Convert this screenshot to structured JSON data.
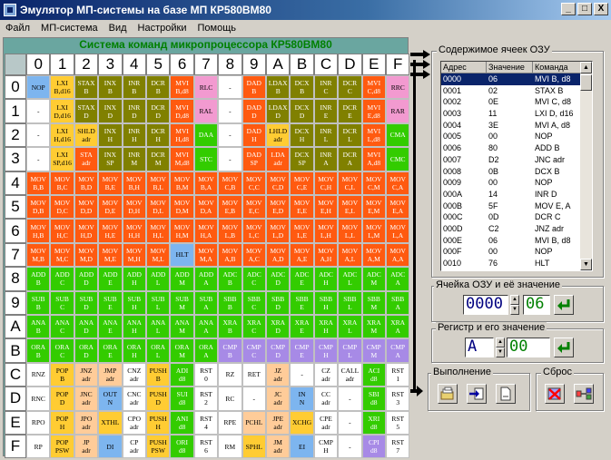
{
  "window": {
    "title": "Эмулятор МП-системы на базе МП КР580ВМ80",
    "min": "_",
    "max": "□",
    "close": "X"
  },
  "menu": [
    "Файл",
    "МП-система",
    "Вид",
    "Настройки",
    "Помощь"
  ],
  "system_title": "Система команд микропроцессора КР580ВМ80",
  "hex_digits": [
    "0",
    "1",
    "2",
    "3",
    "4",
    "5",
    "6",
    "7",
    "8",
    "9",
    "A",
    "B",
    "C",
    "D",
    "E",
    "F"
  ],
  "color_map": {
    "brown": "#808000",
    "orange": "#ff5a10",
    "green": "#33cc00",
    "purple": "#a78ae6",
    "yellow": "#ffcc33",
    "white": "#ffffff",
    "blue": "#7db5ef",
    "pink": "#f29ad0",
    "peach": "#ffcc99",
    "lgreen": "#aaf0a0"
  },
  "opcode_rows": [
    [
      {
        "t": "NOP",
        "c": "blue"
      },
      {
        "t": "LXI B,d16",
        "c": "yellow"
      },
      {
        "t": "STAX B",
        "c": "brown"
      },
      {
        "t": "INX B",
        "c": "brown"
      },
      {
        "t": "INR B",
        "c": "brown"
      },
      {
        "t": "DCR B",
        "c": "brown"
      },
      {
        "t": "MVI B,d8",
        "c": "orange"
      },
      {
        "t": "RLC",
        "c": "pink"
      },
      {
        "t": "-",
        "c": "white"
      },
      {
        "t": "DAD B",
        "c": "orange"
      },
      {
        "t": "LDAX B",
        "c": "brown"
      },
      {
        "t": "DCX B",
        "c": "brown"
      },
      {
        "t": "INR C",
        "c": "brown"
      },
      {
        "t": "DCR C",
        "c": "brown"
      },
      {
        "t": "MVI C,d8",
        "c": "orange"
      },
      {
        "t": "RRC",
        "c": "pink"
      }
    ],
    [
      {
        "t": "-",
        "c": "white"
      },
      {
        "t": "LXI D,d16",
        "c": "yellow"
      },
      {
        "t": "STAX D",
        "c": "brown"
      },
      {
        "t": "INX D",
        "c": "brown"
      },
      {
        "t": "INR D",
        "c": "brown"
      },
      {
        "t": "DCR D",
        "c": "brown"
      },
      {
        "t": "MVI D,d8",
        "c": "orange"
      },
      {
        "t": "RAL",
        "c": "pink"
      },
      {
        "t": "-",
        "c": "white"
      },
      {
        "t": "DAD D",
        "c": "orange"
      },
      {
        "t": "LDAX D",
        "c": "brown"
      },
      {
        "t": "DCX D",
        "c": "brown"
      },
      {
        "t": "INR E",
        "c": "brown"
      },
      {
        "t": "DCR E",
        "c": "brown"
      },
      {
        "t": "MVI E,d8",
        "c": "orange"
      },
      {
        "t": "RAR",
        "c": "pink"
      }
    ],
    [
      {
        "t": "-",
        "c": "white"
      },
      {
        "t": "LXI H,d16",
        "c": "yellow"
      },
      {
        "t": "SHLD adr",
        "c": "yellow"
      },
      {
        "t": "INX H",
        "c": "brown"
      },
      {
        "t": "INR H",
        "c": "brown"
      },
      {
        "t": "DCR H",
        "c": "brown"
      },
      {
        "t": "MVI H,d8",
        "c": "orange"
      },
      {
        "t": "DAA",
        "c": "green"
      },
      {
        "t": "-",
        "c": "white"
      },
      {
        "t": "DAD H",
        "c": "orange"
      },
      {
        "t": "LHLD adr",
        "c": "yellow"
      },
      {
        "t": "DCX H",
        "c": "brown"
      },
      {
        "t": "INR L",
        "c": "brown"
      },
      {
        "t": "DCR L",
        "c": "brown"
      },
      {
        "t": "MVI L,d8",
        "c": "orange"
      },
      {
        "t": "CMA",
        "c": "green"
      }
    ],
    [
      {
        "t": "-",
        "c": "white"
      },
      {
        "t": "LXI SP,d16",
        "c": "yellow"
      },
      {
        "t": "STA adr",
        "c": "orange"
      },
      {
        "t": "INX SP",
        "c": "brown"
      },
      {
        "t": "INR M",
        "c": "brown"
      },
      {
        "t": "DCR M",
        "c": "brown"
      },
      {
        "t": "MVI M,d8",
        "c": "orange"
      },
      {
        "t": "STC",
        "c": "green"
      },
      {
        "t": "-",
        "c": "white"
      },
      {
        "t": "DAD SP",
        "c": "orange"
      },
      {
        "t": "LDA adr",
        "c": "orange"
      },
      {
        "t": "DCX SP",
        "c": "brown"
      },
      {
        "t": "INR A",
        "c": "brown"
      },
      {
        "t": "DCR A",
        "c": "brown"
      },
      {
        "t": "MVI A,d8",
        "c": "orange"
      },
      {
        "t": "CMC",
        "c": "green"
      }
    ],
    [
      {
        "t": "MOV B,B",
        "c": "orange"
      },
      {
        "t": "MOV B,C",
        "c": "orange"
      },
      {
        "t": "MOV B,D",
        "c": "orange"
      },
      {
        "t": "MOV B,E",
        "c": "orange"
      },
      {
        "t": "MOV B,H",
        "c": "orange"
      },
      {
        "t": "MOV B,L",
        "c": "orange"
      },
      {
        "t": "MOV B,M",
        "c": "orange"
      },
      {
        "t": "MOV B,A",
        "c": "orange"
      },
      {
        "t": "MOV C,B",
        "c": "orange"
      },
      {
        "t": "MOV C,C",
        "c": "orange"
      },
      {
        "t": "MOV C,D",
        "c": "orange"
      },
      {
        "t": "MOV C,E",
        "c": "orange"
      },
      {
        "t": "MOV C,H",
        "c": "orange"
      },
      {
        "t": "MOV C,L",
        "c": "orange"
      },
      {
        "t": "MOV C,M",
        "c": "orange"
      },
      {
        "t": "MOV C,A",
        "c": "orange"
      }
    ],
    [
      {
        "t": "MOV D,B",
        "c": "orange"
      },
      {
        "t": "MOV D,C",
        "c": "orange"
      },
      {
        "t": "MOV D,D",
        "c": "orange"
      },
      {
        "t": "MOV D,E",
        "c": "orange"
      },
      {
        "t": "MOV D,H",
        "c": "orange"
      },
      {
        "t": "MOV D,L",
        "c": "orange"
      },
      {
        "t": "MOV D,M",
        "c": "orange"
      },
      {
        "t": "MOV D,A",
        "c": "orange"
      },
      {
        "t": "MOV E,B",
        "c": "orange"
      },
      {
        "t": "MOV E,C",
        "c": "orange"
      },
      {
        "t": "MOV E,D",
        "c": "orange"
      },
      {
        "t": "MOV E,E",
        "c": "orange"
      },
      {
        "t": "MOV E,H",
        "c": "orange"
      },
      {
        "t": "MOV E,L",
        "c": "orange"
      },
      {
        "t": "MOV E,M",
        "c": "orange"
      },
      {
        "t": "MOV E,A",
        "c": "orange"
      }
    ],
    [
      {
        "t": "MOV H,B",
        "c": "orange"
      },
      {
        "t": "MOV H,C",
        "c": "orange"
      },
      {
        "t": "MOV H,D",
        "c": "orange"
      },
      {
        "t": "MOV H,E",
        "c": "orange"
      },
      {
        "t": "MOV H,H",
        "c": "orange"
      },
      {
        "t": "MOV H,L",
        "c": "orange"
      },
      {
        "t": "MOV H,M",
        "c": "orange"
      },
      {
        "t": "MOV H,A",
        "c": "orange"
      },
      {
        "t": "MOV L,B",
        "c": "orange"
      },
      {
        "t": "MOV L,C",
        "c": "orange"
      },
      {
        "t": "MOV L,D",
        "c": "orange"
      },
      {
        "t": "MOV L,E",
        "c": "orange"
      },
      {
        "t": "MOV L,H",
        "c": "orange"
      },
      {
        "t": "MOV L,L",
        "c": "orange"
      },
      {
        "t": "MOV L,M",
        "c": "orange"
      },
      {
        "t": "MOV L,A",
        "c": "orange"
      }
    ],
    [
      {
        "t": "MOV M,B",
        "c": "orange"
      },
      {
        "t": "MOV M,C",
        "c": "orange"
      },
      {
        "t": "MOV M,D",
        "c": "orange"
      },
      {
        "t": "MOV M,E",
        "c": "orange"
      },
      {
        "t": "MOV M,H",
        "c": "orange"
      },
      {
        "t": "MOV M,L",
        "c": "orange"
      },
      {
        "t": "HLT",
        "c": "blue"
      },
      {
        "t": "MOV M,A",
        "c": "orange"
      },
      {
        "t": "MOV A,B",
        "c": "orange"
      },
      {
        "t": "MOV A,C",
        "c": "orange"
      },
      {
        "t": "MOV A,D",
        "c": "orange"
      },
      {
        "t": "MOV A,E",
        "c": "orange"
      },
      {
        "t": "MOV A,H",
        "c": "orange"
      },
      {
        "t": "MOV A,L",
        "c": "orange"
      },
      {
        "t": "MOV A,M",
        "c": "orange"
      },
      {
        "t": "MOV A,A",
        "c": "orange"
      }
    ],
    [
      {
        "t": "ADD B",
        "c": "green"
      },
      {
        "t": "ADD C",
        "c": "green"
      },
      {
        "t": "ADD D",
        "c": "green"
      },
      {
        "t": "ADD E",
        "c": "green"
      },
      {
        "t": "ADD H",
        "c": "green"
      },
      {
        "t": "ADD L",
        "c": "green"
      },
      {
        "t": "ADD M",
        "c": "green"
      },
      {
        "t": "ADD A",
        "c": "green"
      },
      {
        "t": "ADC B",
        "c": "green"
      },
      {
        "t": "ADC C",
        "c": "green"
      },
      {
        "t": "ADC D",
        "c": "green"
      },
      {
        "t": "ADC E",
        "c": "green"
      },
      {
        "t": "ADC H",
        "c": "green"
      },
      {
        "t": "ADC L",
        "c": "green"
      },
      {
        "t": "ADC M",
        "c": "green"
      },
      {
        "t": "ADC A",
        "c": "green"
      }
    ],
    [
      {
        "t": "SUB B",
        "c": "green"
      },
      {
        "t": "SUB C",
        "c": "green"
      },
      {
        "t": "SUB D",
        "c": "green"
      },
      {
        "t": "SUB E",
        "c": "green"
      },
      {
        "t": "SUB H",
        "c": "green"
      },
      {
        "t": "SUB L",
        "c": "green"
      },
      {
        "t": "SUB M",
        "c": "green"
      },
      {
        "t": "SUB A",
        "c": "green"
      },
      {
        "t": "SBB B",
        "c": "green"
      },
      {
        "t": "SBB C",
        "c": "green"
      },
      {
        "t": "SBB D",
        "c": "green"
      },
      {
        "t": "SBB E",
        "c": "green"
      },
      {
        "t": "SBB H",
        "c": "green"
      },
      {
        "t": "SBB L",
        "c": "green"
      },
      {
        "t": "SBB M",
        "c": "green"
      },
      {
        "t": "SBB A",
        "c": "green"
      }
    ],
    [
      {
        "t": "ANA B",
        "c": "green"
      },
      {
        "t": "ANA C",
        "c": "green"
      },
      {
        "t": "ANA D",
        "c": "green"
      },
      {
        "t": "ANA E",
        "c": "green"
      },
      {
        "t": "ANA H",
        "c": "green"
      },
      {
        "t": "ANA L",
        "c": "green"
      },
      {
        "t": "ANA M",
        "c": "green"
      },
      {
        "t": "ANA A",
        "c": "green"
      },
      {
        "t": "XRA B",
        "c": "green"
      },
      {
        "t": "XRA C",
        "c": "green"
      },
      {
        "t": "XRA D",
        "c": "green"
      },
      {
        "t": "XRA E",
        "c": "green"
      },
      {
        "t": "XRA H",
        "c": "green"
      },
      {
        "t": "XRA L",
        "c": "green"
      },
      {
        "t": "XRA M",
        "c": "green"
      },
      {
        "t": "XRA A",
        "c": "green"
      }
    ],
    [
      {
        "t": "ORA B",
        "c": "green"
      },
      {
        "t": "ORA C",
        "c": "green"
      },
      {
        "t": "ORA D",
        "c": "green"
      },
      {
        "t": "ORA E",
        "c": "green"
      },
      {
        "t": "ORA H",
        "c": "green"
      },
      {
        "t": "ORA L",
        "c": "green"
      },
      {
        "t": "ORA M",
        "c": "green"
      },
      {
        "t": "ORA A",
        "c": "green"
      },
      {
        "t": "CMP B",
        "c": "purple"
      },
      {
        "t": "CMP C",
        "c": "purple"
      },
      {
        "t": "CMP D",
        "c": "purple"
      },
      {
        "t": "CMP E",
        "c": "purple"
      },
      {
        "t": "CMP H",
        "c": "purple"
      },
      {
        "t": "CMP L",
        "c": "purple"
      },
      {
        "t": "CMP M",
        "c": "purple"
      },
      {
        "t": "CMP A",
        "c": "purple"
      }
    ],
    [
      {
        "t": "RNZ",
        "c": "white"
      },
      {
        "t": "POP B",
        "c": "yellow"
      },
      {
        "t": "JNZ adr",
        "c": "peach"
      },
      {
        "t": "JMP adr",
        "c": "peach"
      },
      {
        "t": "CNZ adr",
        "c": "white"
      },
      {
        "t": "PUSH B",
        "c": "yellow"
      },
      {
        "t": "ADI d8",
        "c": "green"
      },
      {
        "t": "RST 0",
        "c": "white"
      },
      {
        "t": "RZ",
        "c": "white"
      },
      {
        "t": "RET",
        "c": "white"
      },
      {
        "t": "JZ adr",
        "c": "peach"
      },
      {
        "t": "-",
        "c": "white"
      },
      {
        "t": "CZ adr",
        "c": "white"
      },
      {
        "t": "CALL adr",
        "c": "white"
      },
      {
        "t": "ACI d8",
        "c": "green"
      },
      {
        "t": "RST 1",
        "c": "white"
      }
    ],
    [
      {
        "t": "RNC",
        "c": "white"
      },
      {
        "t": "POP D",
        "c": "yellow"
      },
      {
        "t": "JNC adr",
        "c": "peach"
      },
      {
        "t": "OUT N",
        "c": "blue"
      },
      {
        "t": "CNC adr",
        "c": "white"
      },
      {
        "t": "PUSH D",
        "c": "yellow"
      },
      {
        "t": "SUI d8",
        "c": "green"
      },
      {
        "t": "RST 2",
        "c": "white"
      },
      {
        "t": "RC",
        "c": "white"
      },
      {
        "t": "-",
        "c": "white"
      },
      {
        "t": "JC adr",
        "c": "peach"
      },
      {
        "t": "IN N",
        "c": "blue"
      },
      {
        "t": "CC adr",
        "c": "white"
      },
      {
        "t": "-",
        "c": "white"
      },
      {
        "t": "SBI d8",
        "c": "green"
      },
      {
        "t": "RST 3",
        "c": "white"
      }
    ],
    [
      {
        "t": "RPO",
        "c": "white"
      },
      {
        "t": "POP H",
        "c": "yellow"
      },
      {
        "t": "JPO adr",
        "c": "peach"
      },
      {
        "t": "XTHL",
        "c": "yellow"
      },
      {
        "t": "CPO adr",
        "c": "white"
      },
      {
        "t": "PUSH H",
        "c": "yellow"
      },
      {
        "t": "ANI d8",
        "c": "green"
      },
      {
        "t": "RST 4",
        "c": "white"
      },
      {
        "t": "RPE",
        "c": "white"
      },
      {
        "t": "PCHL",
        "c": "peach"
      },
      {
        "t": "JPE adr",
        "c": "peach"
      },
      {
        "t": "XCHG",
        "c": "yellow"
      },
      {
        "t": "CPE adr",
        "c": "white"
      },
      {
        "t": "-",
        "c": "white"
      },
      {
        "t": "XRI d8",
        "c": "green"
      },
      {
        "t": "RST 5",
        "c": "white"
      }
    ],
    [
      {
        "t": "RP",
        "c": "white"
      },
      {
        "t": "POP PSW",
        "c": "yellow"
      },
      {
        "t": "JP adr",
        "c": "peach"
      },
      {
        "t": "DI",
        "c": "blue"
      },
      {
        "t": "CP adr",
        "c": "white"
      },
      {
        "t": "PUSH PSW",
        "c": "yellow"
      },
      {
        "t": "ORI d8",
        "c": "green"
      },
      {
        "t": "RST 6",
        "c": "white"
      },
      {
        "t": "RM",
        "c": "white"
      },
      {
        "t": "SPHL",
        "c": "yellow"
      },
      {
        "t": "JM adr",
        "c": "peach"
      },
      {
        "t": "EI",
        "c": "blue"
      },
      {
        "t": "CMP H",
        "c": "white"
      },
      {
        "t": "-",
        "c": "white"
      },
      {
        "t": "CPI d8",
        "c": "purple"
      },
      {
        "t": "RST 7",
        "c": "white"
      }
    ]
  ],
  "memory": {
    "group_label": "Содержимое ячеек ОЗУ",
    "columns": [
      "Адрес",
      "Значение",
      "Команда"
    ],
    "rows": [
      [
        "0000",
        "06",
        "MVI B, d8"
      ],
      [
        "0001",
        "02",
        "STAX B"
      ],
      [
        "0002",
        "0E",
        "MVI C, d8"
      ],
      [
        "0003",
        "11",
        "LXI D, d16"
      ],
      [
        "0004",
        "3E",
        "MVI A, d8"
      ],
      [
        "0005",
        "00",
        "NOP"
      ],
      [
        "0006",
        "80",
        "ADD B"
      ],
      [
        "0007",
        "D2",
        "JNC adr"
      ],
      [
        "0008",
        "0B",
        "DCX B"
      ],
      [
        "0009",
        "00",
        "NOP"
      ],
      [
        "000A",
        "14",
        "INR D"
      ],
      [
        "000B",
        "5F",
        "MOV E, A"
      ],
      [
        "000C",
        "0D",
        "DCR C"
      ],
      [
        "000D",
        "C2",
        "JNZ adr"
      ],
      [
        "000E",
        "06",
        "MVI B, d8"
      ],
      [
        "000F",
        "00",
        "NOP"
      ],
      [
        "0010",
        "76",
        "HLT"
      ]
    ]
  },
  "cell_edit": {
    "label": "Ячейка ОЗУ и её значение",
    "address": "0000",
    "value": "06"
  },
  "register_edit": {
    "label": "Регистр и его значение",
    "register": "A",
    "value": "00"
  },
  "exec": {
    "label": "Выполнение"
  },
  "reset": {
    "label": "Сброс"
  }
}
